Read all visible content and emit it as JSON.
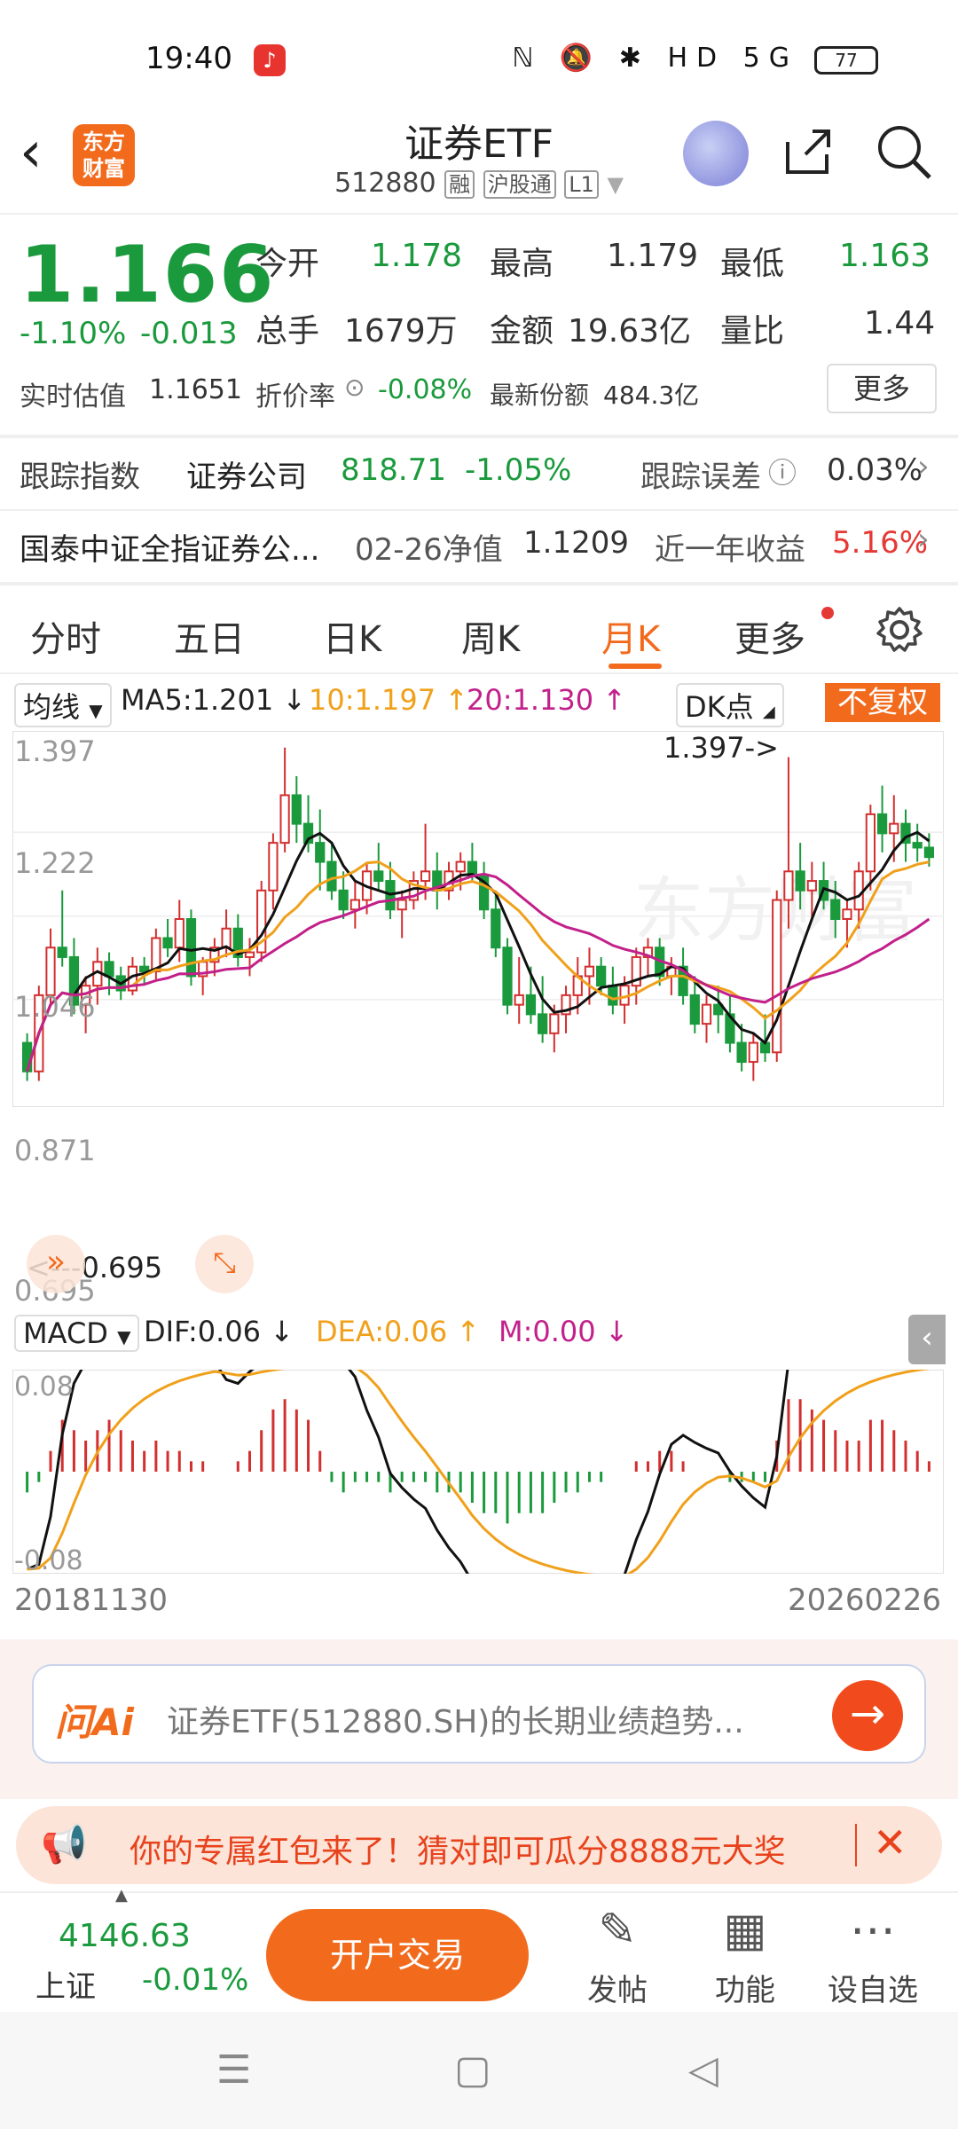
{
  "status_bar": {
    "time": "19:40",
    "icons": "ℕ 🔕 ✱ HD 5G",
    "battery": "77"
  },
  "header": {
    "back_icon": "chevron-left-icon",
    "logo_line1": "东方",
    "logo_line2": "财富",
    "title": "证券ETF",
    "code": "512880",
    "tags": [
      "融",
      "沪股通",
      "L1"
    ]
  },
  "quote": {
    "price": "1.166",
    "change_pct": "-1.10%",
    "change": "-0.013",
    "open_label": "今开",
    "open": "1.178",
    "high_label": "最高",
    "high": "1.179",
    "low_label": "最低",
    "low": "1.163",
    "volume_label": "总手",
    "volume": "1679万",
    "amount_label": "金额",
    "amount": "19.63亿",
    "ratio_label": "量比",
    "ratio": "1.44",
    "iopv_label": "实时估值",
    "iopv": "1.1651",
    "discount_label": "折价率",
    "discount": "-0.08%",
    "shares_label": "最新份额",
    "shares": "484.3亿",
    "more_button": "更多"
  },
  "tracking": {
    "label": "跟踪指数",
    "index_name": "证券公司",
    "index_value": "818.71",
    "index_change": "-1.05%",
    "error_label": "跟踪误差",
    "error_value": "0.03%"
  },
  "fund": {
    "name": "国泰中证全指证券公...",
    "nav_label": "02-26净值",
    "nav": "1.1209",
    "return_label": "近一年收益",
    "return_value": "5.16%"
  },
  "tabs": [
    "分时",
    "五日",
    "日K",
    "周K",
    "月K",
    "更多"
  ],
  "chart_legend": {
    "selector": "均线",
    "ma5": "MA5:1.201 ↓",
    "ma10": "10:1.197 ↑",
    "ma20": "20:1.130 ↑",
    "dk_button": "DK点",
    "adjust_button": "不复权"
  },
  "chart_axis": {
    "y_labels": [
      "1.397",
      "1.222",
      "1.046",
      "0.871",
      "0.695"
    ],
    "max_marker": "1.397->",
    "min_marker": "<---0.695",
    "start_date": "20181130",
    "end_date": "20260226"
  },
  "macd_legend": {
    "selector": "MACD",
    "dif": "DIF:0.06 ↓",
    "dea": "DEA:0.06 ↑",
    "m": "M:0.00 ↓",
    "top_label": "0.08",
    "bottom_label": "-0.08"
  },
  "chart_data": {
    "type": "candlestick",
    "period": "monthly",
    "x_range": [
      "20181130",
      "20260226"
    ],
    "ylim": [
      0.695,
      1.397
    ],
    "ma_colors": {
      "ma5": "#111111",
      "ma10": "#f0a01a",
      "ma20": "#c2208a"
    },
    "up_color": "#d32f2f",
    "down_color": "#1a9a3c",
    "candles_ohlc": [
      [
        0.78,
        0.8,
        0.7,
        0.72
      ],
      [
        0.72,
        0.9,
        0.7,
        0.88
      ],
      [
        0.88,
        1.02,
        0.86,
        0.98
      ],
      [
        0.98,
        1.1,
        0.94,
        0.96
      ],
      [
        0.96,
        1.0,
        0.84,
        0.86
      ],
      [
        0.86,
        0.92,
        0.8,
        0.9
      ],
      [
        0.9,
        0.98,
        0.86,
        0.95
      ],
      [
        0.95,
        0.97,
        0.88,
        0.92
      ],
      [
        0.92,
        0.94,
        0.87,
        0.89
      ],
      [
        0.89,
        0.96,
        0.88,
        0.94
      ],
      [
        0.94,
        0.96,
        0.9,
        0.93
      ],
      [
        0.93,
        1.02,
        0.91,
        1.0
      ],
      [
        1.0,
        1.04,
        0.96,
        0.98
      ],
      [
        0.98,
        1.08,
        0.95,
        1.04
      ],
      [
        1.04,
        1.06,
        0.9,
        0.92
      ],
      [
        0.92,
        0.96,
        0.88,
        0.95
      ],
      [
        0.95,
        1.0,
        0.92,
        0.98
      ],
      [
        0.98,
        1.06,
        0.96,
        1.02
      ],
      [
        1.02,
        1.05,
        0.94,
        0.96
      ],
      [
        0.96,
        1.0,
        0.92,
        0.97
      ],
      [
        0.97,
        1.12,
        0.95,
        1.1
      ],
      [
        1.1,
        1.22,
        1.06,
        1.2
      ],
      [
        1.2,
        1.4,
        1.18,
        1.3
      ],
      [
        1.3,
        1.34,
        1.2,
        1.24
      ],
      [
        1.24,
        1.3,
        1.18,
        1.2
      ],
      [
        1.2,
        1.27,
        1.1,
        1.16
      ],
      [
        1.16,
        1.2,
        1.08,
        1.1
      ],
      [
        1.1,
        1.14,
        1.04,
        1.06
      ],
      [
        1.06,
        1.12,
        1.02,
        1.08
      ],
      [
        1.08,
        1.16,
        1.05,
        1.14
      ],
      [
        1.14,
        1.2,
        1.1,
        1.12
      ],
      [
        1.12,
        1.16,
        1.04,
        1.06
      ],
      [
        1.06,
        1.1,
        1.0,
        1.08
      ],
      [
        1.08,
        1.14,
        1.06,
        1.12
      ],
      [
        1.12,
        1.24,
        1.08,
        1.14
      ],
      [
        1.14,
        1.18,
        1.06,
        1.1
      ],
      [
        1.1,
        1.16,
        1.08,
        1.14
      ],
      [
        1.14,
        1.18,
        1.1,
        1.16
      ],
      [
        1.16,
        1.2,
        1.12,
        1.13
      ],
      [
        1.13,
        1.16,
        1.04,
        1.06
      ],
      [
        1.06,
        1.1,
        0.96,
        0.98
      ],
      [
        0.98,
        1.0,
        0.84,
        0.86
      ],
      [
        0.86,
        0.96,
        0.82,
        0.88
      ],
      [
        0.88,
        0.94,
        0.82,
        0.84
      ],
      [
        0.84,
        0.92,
        0.78,
        0.8
      ],
      [
        0.8,
        0.86,
        0.76,
        0.84
      ],
      [
        0.84,
        0.9,
        0.8,
        0.88
      ],
      [
        0.88,
        0.96,
        0.84,
        0.92
      ],
      [
        0.92,
        0.98,
        0.86,
        0.94
      ],
      [
        0.94,
        0.96,
        0.88,
        0.9
      ],
      [
        0.9,
        0.94,
        0.84,
        0.86
      ],
      [
        0.86,
        0.92,
        0.82,
        0.9
      ],
      [
        0.9,
        0.98,
        0.86,
        0.96
      ],
      [
        0.96,
        1.0,
        0.92,
        0.98
      ],
      [
        0.98,
        1.0,
        0.9,
        0.92
      ],
      [
        0.92,
        0.96,
        0.88,
        0.94
      ],
      [
        0.94,
        0.98,
        0.86,
        0.88
      ],
      [
        0.88,
        0.92,
        0.8,
        0.82
      ],
      [
        0.82,
        0.88,
        0.78,
        0.86
      ],
      [
        0.86,
        0.9,
        0.8,
        0.84
      ],
      [
        0.84,
        0.88,
        0.76,
        0.78
      ],
      [
        0.78,
        0.82,
        0.72,
        0.74
      ],
      [
        0.74,
        0.8,
        0.7,
        0.78
      ],
      [
        0.78,
        0.84,
        0.74,
        0.76
      ],
      [
        0.76,
        1.1,
        0.74,
        1.08
      ],
      [
        1.08,
        1.38,
        1.02,
        1.14
      ],
      [
        1.14,
        1.2,
        1.06,
        1.1
      ],
      [
        1.1,
        1.16,
        1.04,
        1.12
      ],
      [
        1.12,
        1.16,
        1.06,
        1.08
      ],
      [
        1.08,
        1.12,
        1.0,
        1.04
      ],
      [
        1.04,
        1.08,
        0.98,
        1.06
      ],
      [
        1.06,
        1.16,
        1.02,
        1.14
      ],
      [
        1.14,
        1.28,
        1.1,
        1.26
      ],
      [
        1.26,
        1.32,
        1.18,
        1.22
      ],
      [
        1.22,
        1.3,
        1.16,
        1.24
      ],
      [
        1.24,
        1.27,
        1.16,
        1.2
      ],
      [
        1.2,
        1.24,
        1.16,
        1.19
      ],
      [
        1.19,
        1.22,
        1.15,
        1.17
      ]
    ],
    "macd_hist": [
      -0.02,
      -0.01,
      0.02,
      0.05,
      0.04,
      0.03,
      0.04,
      0.05,
      0.04,
      0.03,
      0.02,
      0.03,
      0.02,
      0.02,
      0.01,
      0.01,
      0.0,
      0.0,
      0.01,
      0.02,
      0.04,
      0.06,
      0.07,
      0.06,
      0.05,
      0.02,
      -0.01,
      -0.02,
      -0.01,
      -0.01,
      -0.01,
      -0.02,
      -0.01,
      -0.01,
      -0.01,
      -0.02,
      -0.02,
      -0.02,
      -0.03,
      -0.04,
      -0.04,
      -0.05,
      -0.04,
      -0.04,
      -0.04,
      -0.03,
      -0.02,
      -0.02,
      -0.01,
      -0.01,
      0.0,
      0.0,
      0.01,
      0.01,
      0.02,
      0.02,
      0.01,
      0.0,
      0.0,
      0.0,
      -0.01,
      -0.01,
      -0.01,
      -0.01,
      0.03,
      0.07,
      0.07,
      0.06,
      0.05,
      0.04,
      0.03,
      0.03,
      0.05,
      0.05,
      0.04,
      0.03,
      0.02,
      0.01
    ]
  },
  "ai_bar": {
    "logo": "问Ai",
    "text": "证券ETF(512880.SH)的长期业绩趋势...",
    "button_icon": "arrow-right-icon"
  },
  "promo": {
    "text": "你的专属红包来了！猜对即可瓜分8888元大奖"
  },
  "bottom_bar": {
    "index_value": "4146.63",
    "index_name": "上证",
    "index_change": "-0.01%",
    "trade_button": "开户交易",
    "post_label": "发帖",
    "function_label": "功能",
    "watchlist_label": "设自选"
  }
}
